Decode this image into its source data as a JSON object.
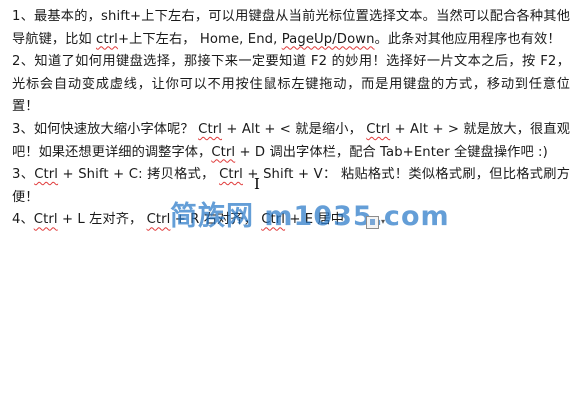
{
  "document": {
    "paragraphs": [
      {
        "segments": [
          {
            "text": "1、最基本的，shift+上下左右，可以用键盘从当前光标位置选择文本。当然可以配合各种其他导航键，比如 ",
            "squiggle": false
          },
          {
            "text": "ctrl",
            "squiggle": true
          },
          {
            "text": "+上下左右， Home, End, ",
            "squiggle": false
          },
          {
            "text": "PageUp/Down",
            "squiggle": true
          },
          {
            "text": "。此条对其他应用程序也有效！",
            "squiggle": false
          }
        ]
      },
      {
        "segments": [
          {
            "text": "2、知道了如何用键盘选择，那接下来一定要知道 F2 的妙用！选择好一片文本之后，按 F2，光标会自动变成虚线，让你可以不用按住鼠标左键拖动，而是用键盘的方式，移动到任意位置！",
            "squiggle": false
          }
        ]
      },
      {
        "segments": [
          {
            "text": "3、如何快速放大缩小字体呢？ ",
            "squiggle": false
          },
          {
            "text": "Ctrl",
            "squiggle": true
          },
          {
            "text": " + Alt + <  就是缩小，  ",
            "squiggle": false
          },
          {
            "text": "Ctrl",
            "squiggle": true
          },
          {
            "text": " + Alt + >  就是放大，很直观吧！如果还想更详细的调整字体，",
            "squiggle": false
          },
          {
            "text": "Ctrl",
            "squiggle": true
          },
          {
            "text": " + D 调出字体栏，配合 Tab+Enter 全键盘操作吧 :)",
            "squiggle": false
          }
        ]
      },
      {
        "segments": [
          {
            "text": "3、",
            "squiggle": false
          },
          {
            "text": "Ctrl",
            "squiggle": true
          },
          {
            "text": " + Shift + C:  拷贝格式，  ",
            "squiggle": false
          },
          {
            "text": "Ctrl",
            "squiggle": true
          },
          {
            "text": " + Shift + V：  粘贴格式！类似格式刷，但比格式刷方便！",
            "squiggle": false
          }
        ]
      },
      {
        "segments": [
          {
            "text": "4、",
            "squiggle": false
          },
          {
            "text": "Ctrl",
            "squiggle": true
          },
          {
            "text": " + L  左对齐，  ",
            "squiggle": false
          },
          {
            "text": "Ctrl",
            "squiggle": true
          },
          {
            "text": " + R  右对齐，  ",
            "squiggle": false
          },
          {
            "text": "Ctrl",
            "squiggle": true
          },
          {
            "text": " + E  居中",
            "squiggle": false
          }
        ]
      }
    ]
  },
  "watermark": {
    "text": "简族网 m1035.com",
    "color": "#2878c8"
  },
  "cursor": {
    "icon": "text-ibeam-cursor-icon",
    "glyph": "I"
  },
  "paste_options": {
    "icon": "paste-options-icon",
    "caret_glyph": "▾"
  }
}
